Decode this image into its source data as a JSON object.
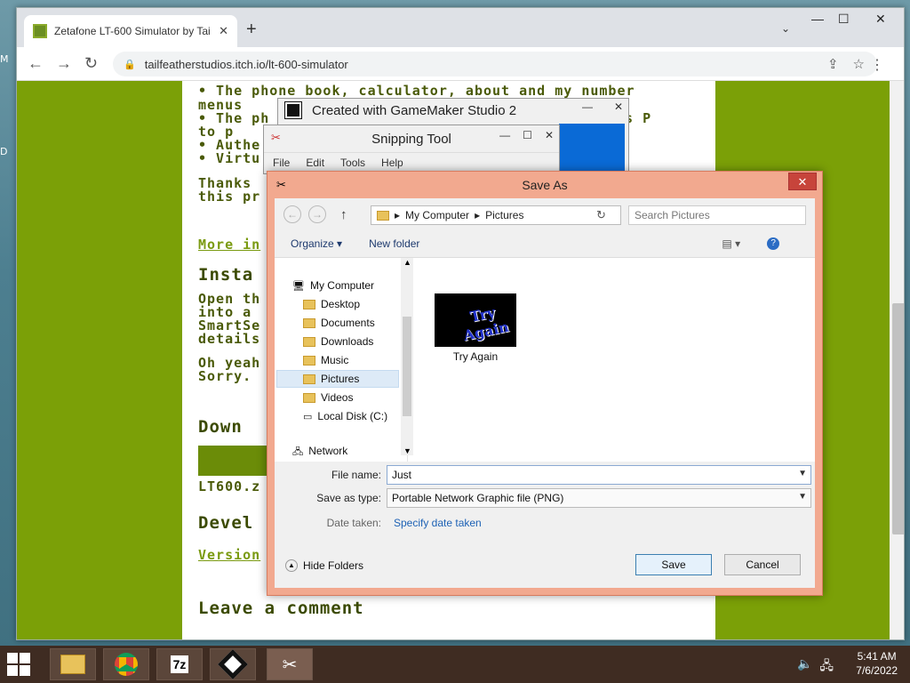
{
  "desktop": {
    "edge_m": "M",
    "edge_d": "D"
  },
  "browser": {
    "tab_title": "Zetafone LT-600 Simulator by Tai",
    "tab_close": "✕",
    "new_tab": "+",
    "tab_menu": "⌄",
    "win_minimize": "—",
    "win_maximize": "☐",
    "win_close": "✕",
    "back": "←",
    "forward": "→",
    "reload": "↻",
    "lock": "🔒",
    "url": "tailfeatherstudios.itch.io/lt-600-simulator",
    "share": "⇪",
    "bookmark": "☆",
    "sidepanel": "▮",
    "profile": "●",
    "menu": "⋮"
  },
  "page": {
    "line1": "• The phone book, calculator, about and my number",
    "line2": "  menus",
    "line3": "• The ph",
    "line3b": "ss P",
    "line4": "  to p",
    "line5": "• Authe",
    "line6": "• Virtu",
    "thanks1": "Thanks",
    "thanks2": "this pr",
    "more": "More in",
    "install": "Insta",
    "open1": "Open th",
    "open2": "into a",
    "open3": "SmartSe",
    "open4": "details",
    "oh1": "Oh yeah",
    "oh2": "Sorry.",
    "download": "Down",
    "lt600": "LT600.z",
    "devel": "Devel",
    "version": "Version",
    "leave": "Leave a comment"
  },
  "gamemaker": {
    "title": "Created with GameMaker Studio 2",
    "min": "—",
    "close": "✕"
  },
  "snipping": {
    "title": "Snipping Tool",
    "min": "—",
    "max": "☐",
    "close": "✕",
    "menu": [
      "File",
      "Edit",
      "Tools",
      "Help"
    ]
  },
  "saveas": {
    "title": "Save As",
    "close": "✕",
    "back": "←",
    "forward": "→",
    "up": "↑",
    "path": [
      "My Computer",
      "Pictures"
    ],
    "sep": "▸",
    "search_placeholder": "Search Pictures",
    "organize": "Organize ▾",
    "new_folder": "New folder",
    "view": "▤ ▾",
    "help": "?",
    "tree": [
      {
        "label": "My Computer"
      },
      {
        "label": "Desktop"
      },
      {
        "label": "Documents"
      },
      {
        "label": "Downloads"
      },
      {
        "label": "Music"
      },
      {
        "label": "Pictures"
      },
      {
        "label": "Videos"
      },
      {
        "label": "Local Disk (C:)"
      },
      {
        "label": "Network"
      }
    ],
    "file_name_thumb": "Try Again",
    "file_label": "Try Again",
    "file_name_label": "File name:",
    "file_name_value": "Just",
    "save_type_label": "Save as type:",
    "save_type_value": "Portable Network Graphic file (PNG)",
    "date_label": "Date taken:",
    "date_link": "Specify date taken",
    "hide_folders": "Hide Folders",
    "save": "Save",
    "cancel": "Cancel"
  },
  "taskbar": {
    "time": "5:41 AM",
    "date": "7/6/2022",
    "sevenzip": "7z"
  }
}
